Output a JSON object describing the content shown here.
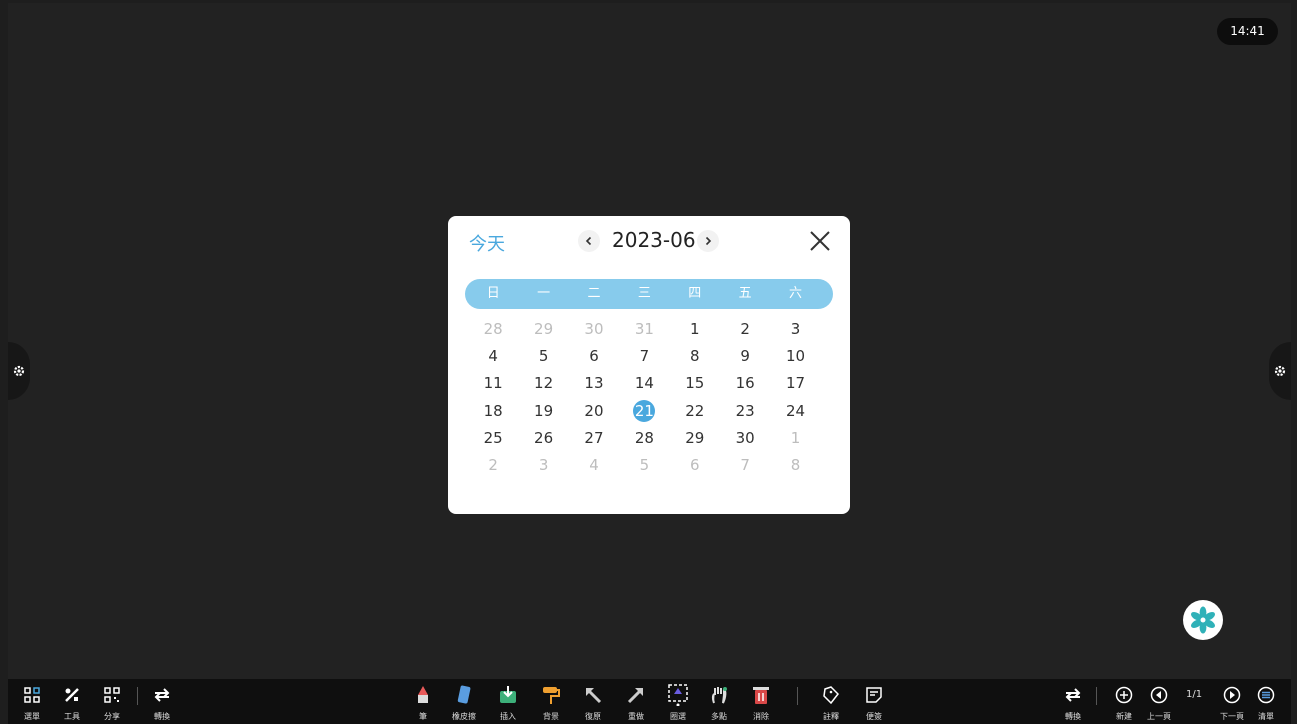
{
  "clock": "14:41",
  "calendar": {
    "today_label": "今天",
    "month": "2023-06",
    "weekdays": [
      "日",
      "一",
      "二",
      "三",
      "四",
      "五",
      "六"
    ],
    "weeks": [
      [
        {
          "d": "28",
          "m": 1
        },
        {
          "d": "29",
          "m": 1
        },
        {
          "d": "30",
          "m": 1
        },
        {
          "d": "31",
          "m": 1
        },
        {
          "d": "1",
          "m": 0
        },
        {
          "d": "2",
          "m": 0
        },
        {
          "d": "3",
          "m": 0
        }
      ],
      [
        {
          "d": "4",
          "m": 0
        },
        {
          "d": "5",
          "m": 0
        },
        {
          "d": "6",
          "m": 0
        },
        {
          "d": "7",
          "m": 0
        },
        {
          "d": "8",
          "m": 0
        },
        {
          "d": "9",
          "m": 0
        },
        {
          "d": "10",
          "m": 0
        }
      ],
      [
        {
          "d": "11",
          "m": 0
        },
        {
          "d": "12",
          "m": 0
        },
        {
          "d": "13",
          "m": 0
        },
        {
          "d": "14",
          "m": 0
        },
        {
          "d": "15",
          "m": 0
        },
        {
          "d": "16",
          "m": 0
        },
        {
          "d": "17",
          "m": 0
        }
      ],
      [
        {
          "d": "18",
          "m": 0
        },
        {
          "d": "19",
          "m": 0
        },
        {
          "d": "20",
          "m": 0
        },
        {
          "d": "21",
          "m": 0,
          "sel": 1
        },
        {
          "d": "22",
          "m": 0
        },
        {
          "d": "23",
          "m": 0
        },
        {
          "d": "24",
          "m": 0
        }
      ],
      [
        {
          "d": "25",
          "m": 0
        },
        {
          "d": "26",
          "m": 0
        },
        {
          "d": "27",
          "m": 0
        },
        {
          "d": "28",
          "m": 0
        },
        {
          "d": "29",
          "m": 0
        },
        {
          "d": "30",
          "m": 0
        },
        {
          "d": "1",
          "m": 1
        }
      ],
      [
        {
          "d": "2",
          "m": 1
        },
        {
          "d": "3",
          "m": 1
        },
        {
          "d": "4",
          "m": 1
        },
        {
          "d": "5",
          "m": 1
        },
        {
          "d": "6",
          "m": 1
        },
        {
          "d": "7",
          "m": 1
        },
        {
          "d": "8",
          "m": 1
        }
      ]
    ],
    "accent_color": "#4aa8de",
    "header_bar_color": "#87cbec"
  },
  "toolbar": {
    "menu": "選單",
    "tools": "工具",
    "share": "分享",
    "switch_left": "轉換",
    "pen": "筆",
    "eraser": "橡皮擦",
    "insert": "插入",
    "background": "背景",
    "undo": "復原",
    "redo": "重做",
    "select": "圈選",
    "multi_touch": "多點",
    "clear": "消除",
    "annotate": "註釋",
    "note": "便簽",
    "switch_right": "轉換",
    "new_page": "新建",
    "prev_page": "上一頁",
    "page_indicator": "1/1",
    "next_page": "下一頁",
    "page_list": "清單"
  }
}
